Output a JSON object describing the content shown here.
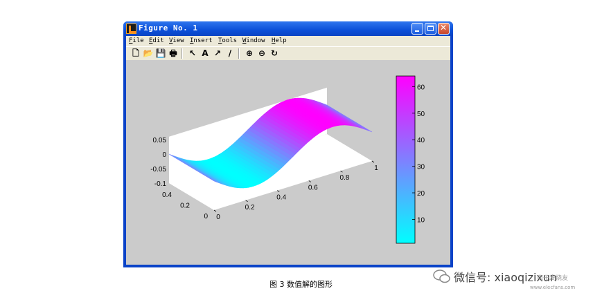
{
  "window": {
    "title": "Figure No. 1",
    "menu": [
      "File",
      "Edit",
      "View",
      "Insert",
      "Tools",
      "Window",
      "Help"
    ],
    "toolbar_icons": [
      "new-file-icon",
      "open-folder-icon",
      "save-icon",
      "print-icon",
      "arrow-pointer-icon",
      "text-icon",
      "arrow-line-icon",
      "line-icon",
      "zoom-in-icon",
      "zoom-out-icon",
      "rotate-icon"
    ],
    "toolbar_glyphs": [
      "🗋",
      "📂",
      "💾",
      "🖶",
      "↖",
      "A",
      "↗",
      "/",
      "⊕",
      "⊖",
      "↻"
    ]
  },
  "chart_data": {
    "type": "surface",
    "x_ticks": [
      "0",
      "0.2",
      "0.4",
      "0.6",
      "0.8",
      "1"
    ],
    "y_ticks": [
      "0",
      "0.2",
      "0.4"
    ],
    "z_ticks": [
      "0.05",
      "0",
      "-0.05",
      "-0.1"
    ],
    "colorbar_ticks": [
      "10",
      "20",
      "30",
      "40",
      "50",
      "60"
    ],
    "colorbar_range": [
      1,
      64
    ],
    "colormap": [
      "#00ffff",
      "#ff00ff"
    ],
    "surface_function": "z = -0.06*sin(2*pi*x)"
  },
  "caption": "图 3 数值解的图形",
  "watermark": {
    "handle": "微信号: xiaoqizixun",
    "site": "www.elecfans.com",
    "brand": "电子发烧友"
  }
}
